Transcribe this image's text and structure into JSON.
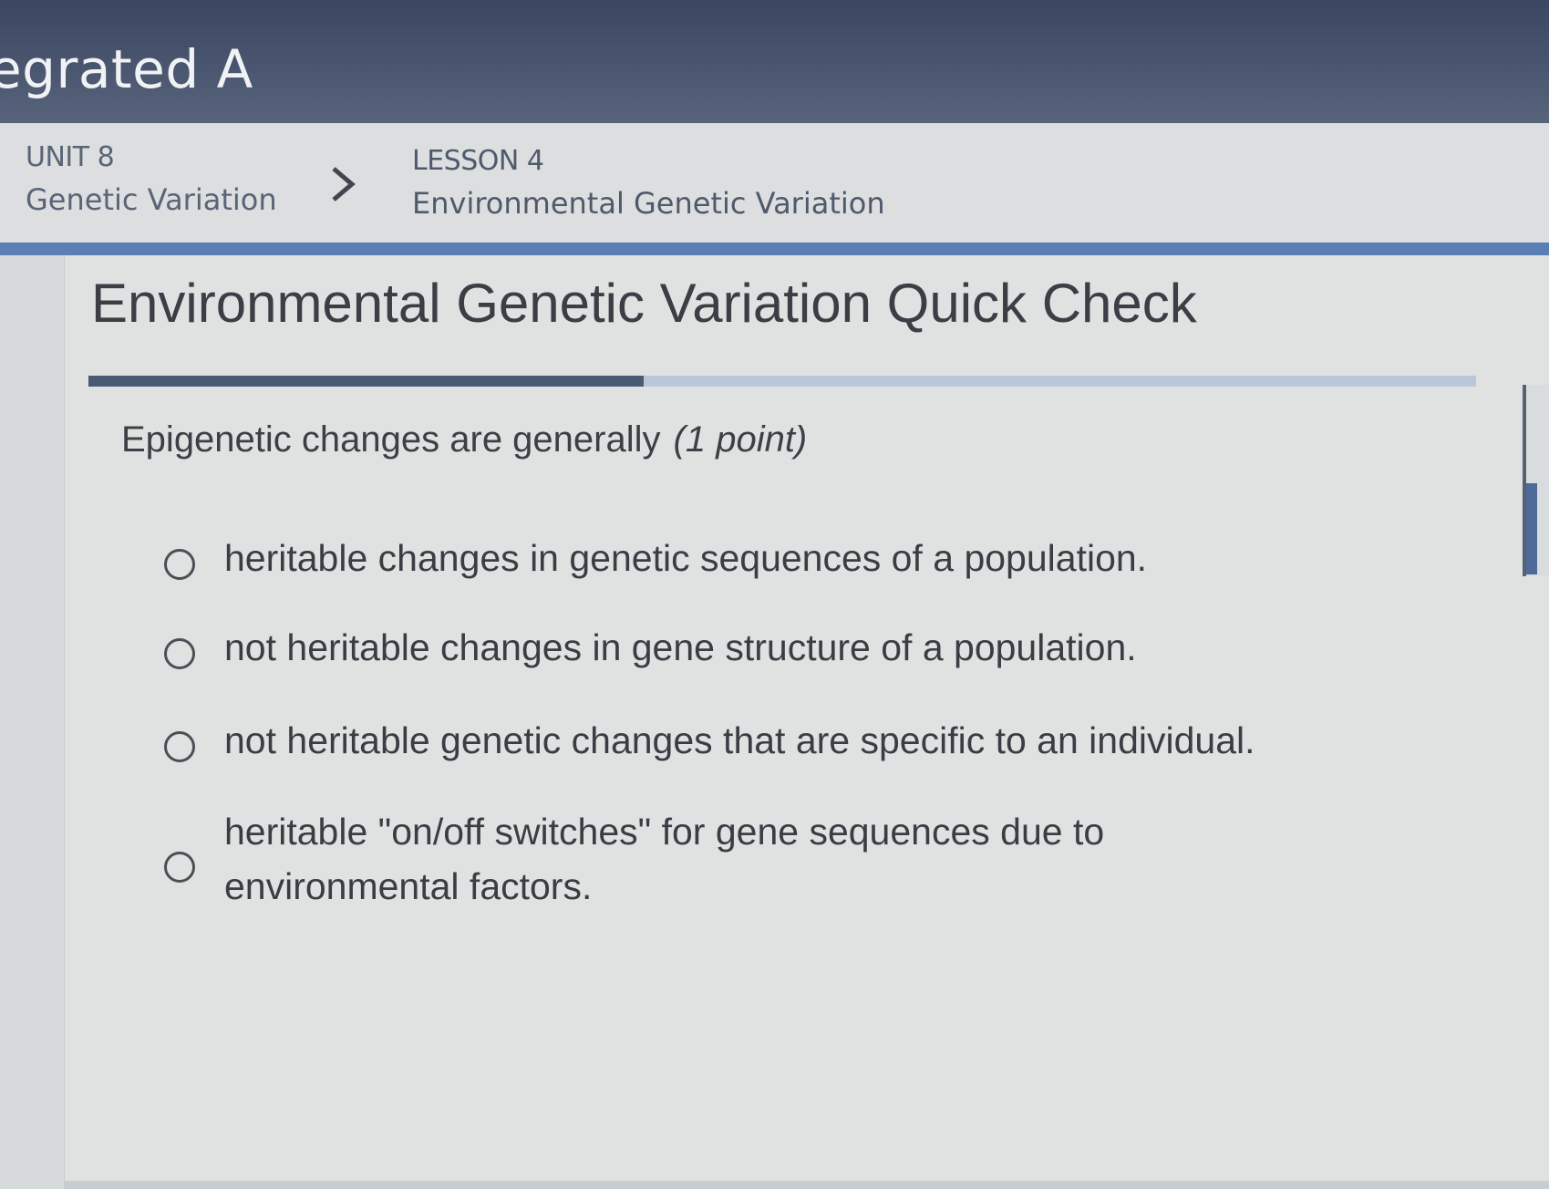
{
  "header": {
    "course_title": "egrated A"
  },
  "breadcrumb": {
    "unit_label": "UNIT 8",
    "unit_title": "Genetic Variation",
    "lesson_label": "LESSON 4",
    "lesson_title": "Environmental Genetic Variation"
  },
  "main": {
    "page_title": "Environmental Genetic Variation Quick Check",
    "progress_fraction": 0.4,
    "question": {
      "prompt": "Epigenetic changes are generally",
      "points": "(1 point)",
      "options": [
        "heritable changes in genetic sequences of a population.",
        "not heritable changes in gene structure of a population.",
        "not heritable genetic changes that are specific to an individual.",
        "heritable \"on/off switches\" for gene sequences due to environmental factors."
      ],
      "selected": null
    }
  },
  "icons": {
    "breadcrumb_separator": "chevron-right-icon"
  },
  "colors": {
    "header_bg": "#46526b",
    "accent_blue": "#5a7fb5",
    "progress_fill": "#4a5a74"
  }
}
